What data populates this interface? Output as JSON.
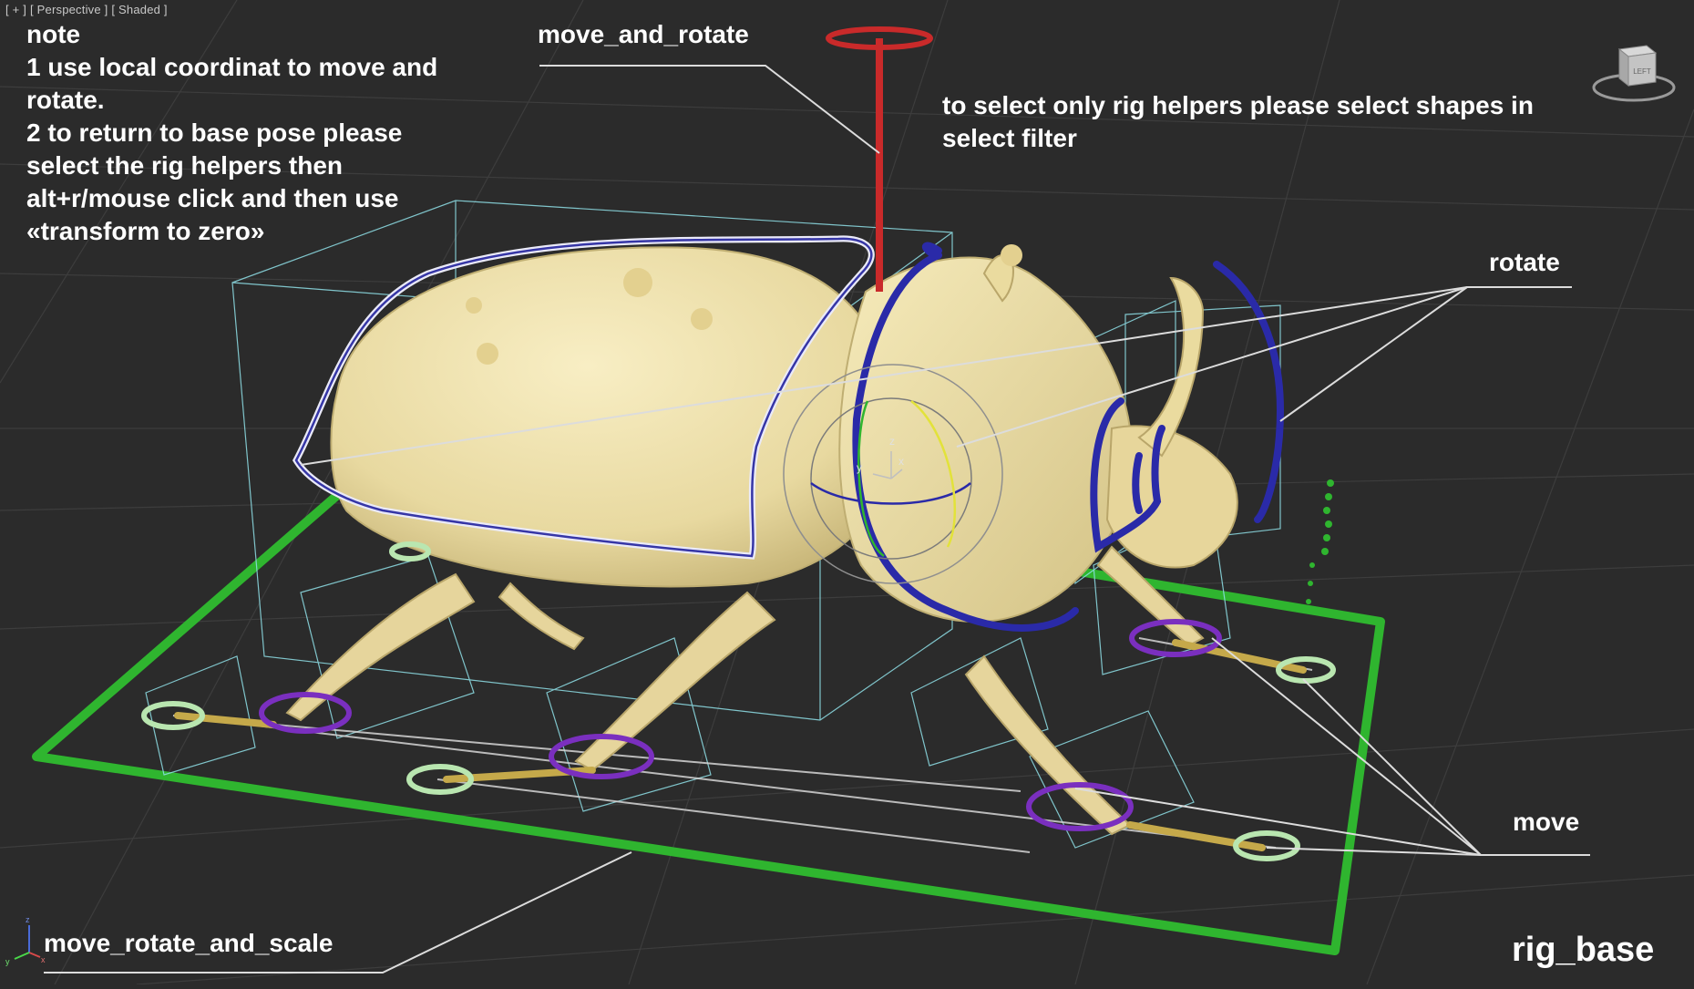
{
  "viewport": {
    "labels": [
      "[ + ]",
      "[ Perspective ]",
      "[ Shaded ]"
    ]
  },
  "note": {
    "title": "note",
    "lines": [
      "1 use local coordinat to move and",
      "rotate.",
      "2 to return to base pose please",
      "select the rig helpers then",
      "alt+r/mouse click and then use",
      "«transform to zero»"
    ]
  },
  "labels": {
    "move_and_rotate": "move_and_rotate",
    "filter_hint": [
      "to select only rig helpers please select shapes in",
      "select filter"
    ],
    "rotate": "rotate",
    "move": "move",
    "move_rotate_and_scale": "move_rotate_and_scale",
    "rig_base": "rig_base"
  },
  "viewcube": {
    "face": "LEFT"
  },
  "axis_tripod": {
    "z": "z",
    "x": "x",
    "y": "y"
  },
  "gizmo_axes": {
    "z": "z",
    "x": "x",
    "y": "y"
  },
  "colors": {
    "background": "#2b2b2b",
    "grid": "#3c3c3c",
    "beetle": "#eedfa6",
    "rig_base": "#2fb52f",
    "rotate_helper": "#2a2aa8",
    "move_and_rotate_helper": "#c92a2a",
    "move_helper_ring": "#b9e6b0",
    "purple_ring": "#7a2fbf",
    "bounding_box": "#8fe0e8",
    "leader_line": "#dcdcdc"
  }
}
